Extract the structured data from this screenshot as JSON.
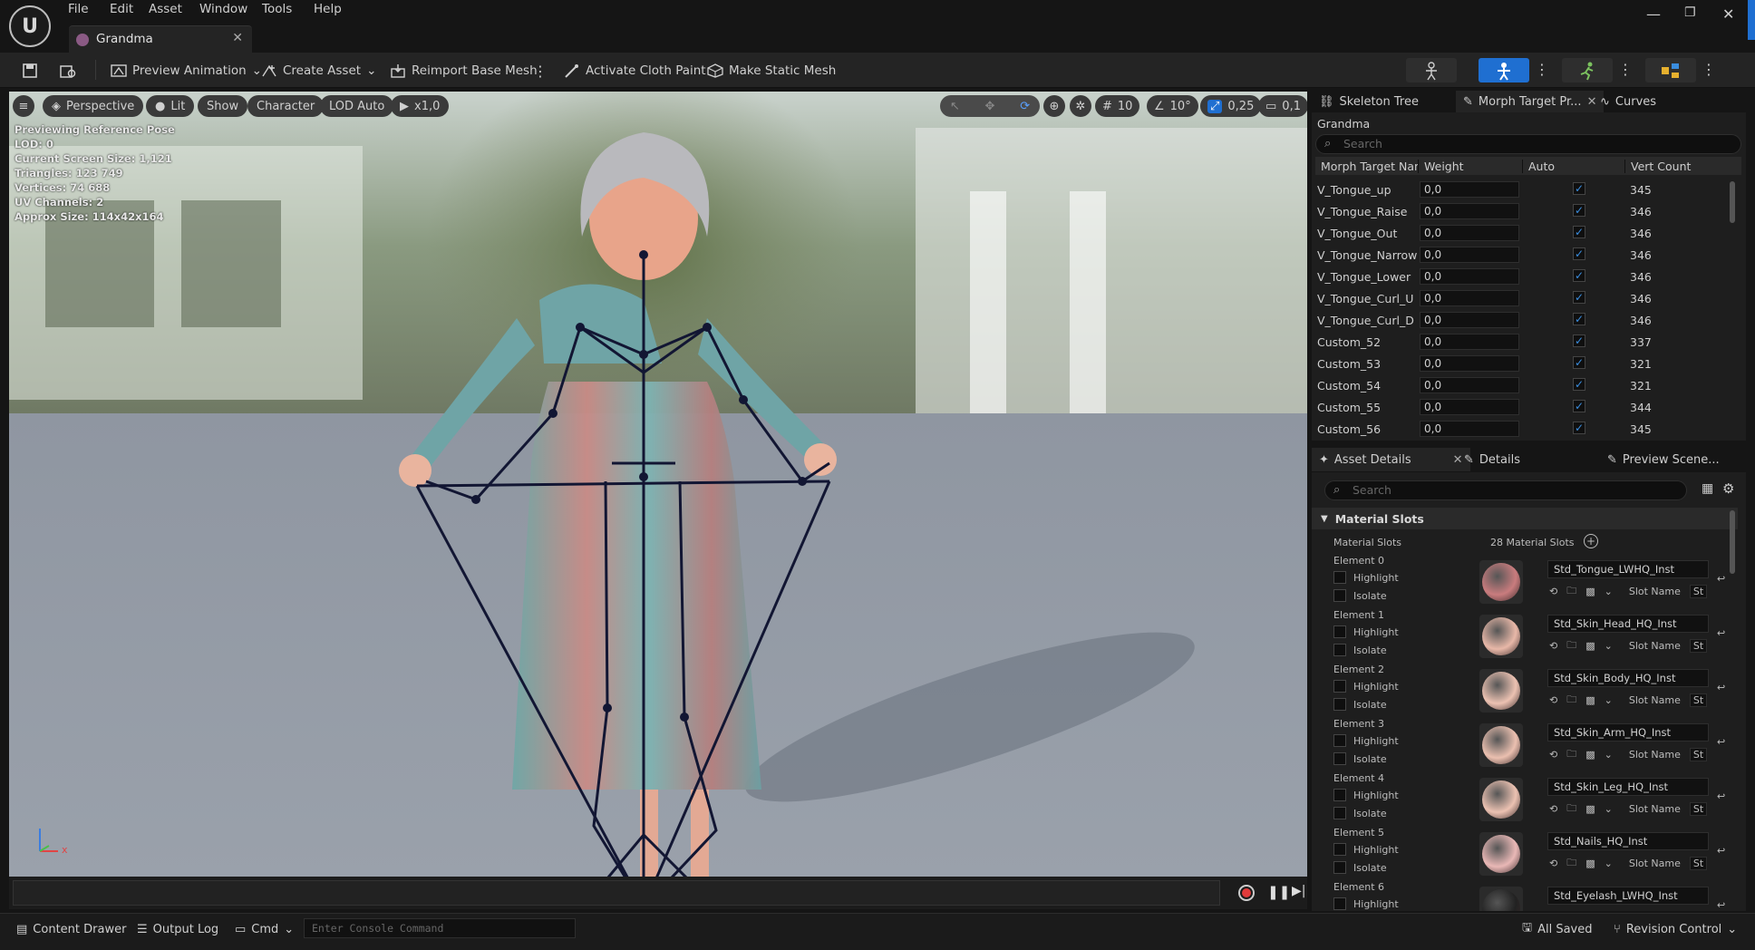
{
  "menu": [
    "File",
    "Edit",
    "Asset",
    "Window",
    "Tools",
    "Help"
  ],
  "tab": {
    "title": "Grandma"
  },
  "toolbar": {
    "preview_animation": "Preview Animation",
    "create_asset": "Create Asset",
    "reimport": "Reimport Base Mesh",
    "cloth_paint": "Activate Cloth Paint",
    "static_mesh": "Make Static Mesh"
  },
  "viewport": {
    "perspective": "Perspective",
    "lit": "Lit",
    "show": "Show",
    "character": "Character",
    "lod": "LOD Auto",
    "speed": "x1,0",
    "grid": "10",
    "angle": "10°",
    "scale": "0,25",
    "cam": "0,1",
    "stats": [
      "Previewing Reference Pose",
      "LOD: 0",
      "Current Screen Size: 1,121",
      "Triangles: 123 749",
      "Vertices: 74 688",
      "UV Channels: 2",
      "Approx Size: 114x42x164"
    ],
    "axis_x": "x"
  },
  "morph_panel": {
    "tabs": [
      "Skeleton Tree",
      "Morph Target Pr...",
      "Curves"
    ],
    "asset": "Grandma",
    "search_placeholder": "Search",
    "columns": [
      "Morph Target Nam",
      "Weight",
      "Auto",
      "Vert Count"
    ],
    "rows": [
      {
        "name": "V_Tongue_up",
        "weight": "0,0",
        "auto": true,
        "count": "345"
      },
      {
        "name": "V_Tongue_Raise",
        "weight": "0,0",
        "auto": true,
        "count": "346"
      },
      {
        "name": "V_Tongue_Out",
        "weight": "0,0",
        "auto": true,
        "count": "346"
      },
      {
        "name": "V_Tongue_Narrow",
        "weight": "0,0",
        "auto": true,
        "count": "346"
      },
      {
        "name": "V_Tongue_Lower",
        "weight": "0,0",
        "auto": true,
        "count": "346"
      },
      {
        "name": "V_Tongue_Curl_U",
        "weight": "0,0",
        "auto": true,
        "count": "346"
      },
      {
        "name": "V_Tongue_Curl_D",
        "weight": "0,0",
        "auto": true,
        "count": "346"
      },
      {
        "name": "Custom_52",
        "weight": "0,0",
        "auto": true,
        "count": "337"
      },
      {
        "name": "Custom_53",
        "weight": "0,0",
        "auto": true,
        "count": "321"
      },
      {
        "name": "Custom_54",
        "weight": "0,0",
        "auto": true,
        "count": "321"
      },
      {
        "name": "Custom_55",
        "weight": "0,0",
        "auto": true,
        "count": "344"
      },
      {
        "name": "Custom_56",
        "weight": "0,0",
        "auto": true,
        "count": "345"
      }
    ]
  },
  "details_panel": {
    "tabs": [
      "Asset Details",
      "Details",
      "Preview Scene..."
    ],
    "search_placeholder": "Search",
    "section": "Material Slots",
    "slots_label": "Material Slots",
    "slots_count": "28 Material Slots",
    "highlight": "Highlight",
    "isolate": "Isolate",
    "slot_name": "Slot Name",
    "slot_value": "St",
    "elements": [
      {
        "label": "Element 0",
        "material": "Std_Tongue_LWHQ_Inst",
        "color": "#c97c7e"
      },
      {
        "label": "Element 1",
        "material": "Std_Skin_Head_HQ_Inst",
        "color": "#e8b8a8"
      },
      {
        "label": "Element 2",
        "material": "Std_Skin_Body_HQ_Inst",
        "color": "#ecc2b2"
      },
      {
        "label": "Element 3",
        "material": "Std_Skin_Arm_HQ_Inst",
        "color": "#ebc0b0"
      },
      {
        "label": "Element 4",
        "material": "Std_Skin_Leg_HQ_Inst",
        "color": "#ecc2b2"
      },
      {
        "label": "Element 5",
        "material": "Std_Nails_HQ_Inst",
        "color": "#e9b8b6"
      },
      {
        "label": "Element 6",
        "material": "Std_Eyelash_LWHQ_Inst",
        "color": "#222222"
      }
    ]
  },
  "bottom": {
    "content_drawer": "Content Drawer",
    "output_log": "Output Log",
    "cmd": "Cmd",
    "console_placeholder": "Enter Console Command",
    "saved": "All Saved",
    "revision": "Revision Control"
  }
}
